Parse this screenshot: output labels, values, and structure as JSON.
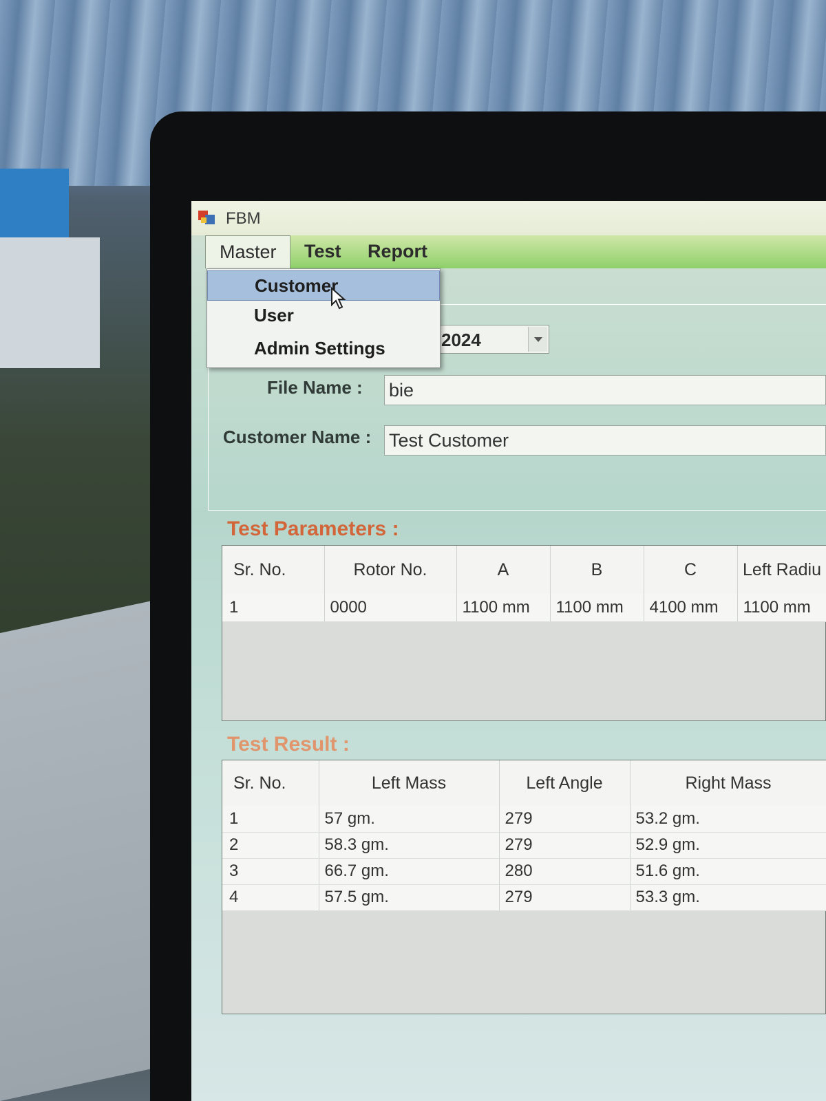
{
  "window": {
    "title": "FBM"
  },
  "menubar": {
    "items": [
      "Master",
      "Test",
      "Report"
    ]
  },
  "master_menu": {
    "items": [
      "Customer",
      "User",
      "Admin Settings"
    ],
    "highlighted": "Customer"
  },
  "form": {
    "date_value": "2024",
    "file_name_label": "File Name :",
    "file_name_value": "bie",
    "customer_name_label": "Customer Name :",
    "customer_name_value": "Test Customer"
  },
  "test_parameters": {
    "heading": "Test Parameters :",
    "columns": [
      "Sr. No.",
      "Rotor No.",
      "A",
      "B",
      "C",
      "Left Radiu"
    ],
    "rows": [
      [
        "1",
        "0000",
        "1100 mm",
        "1100 mm",
        "4100 mm",
        "1100 mm"
      ]
    ]
  },
  "test_result": {
    "heading": "Test Result :",
    "columns": [
      "Sr. No.",
      "Left Mass",
      "Left Angle",
      "Right Mass"
    ],
    "rows": [
      [
        "1",
        "57 gm.",
        "279",
        "53.2 gm."
      ],
      [
        "2",
        "58.3 gm.",
        "279",
        "52.9 gm."
      ],
      [
        "3",
        "66.7 gm.",
        "280",
        "51.6 gm."
      ],
      [
        "4",
        "57.5 gm.",
        "279",
        "53.3 gm."
      ]
    ]
  },
  "colors": {
    "section_heading": "#d2663a",
    "menu_highlight": "#a6bfdc",
    "menubar": "#8fd06a"
  }
}
